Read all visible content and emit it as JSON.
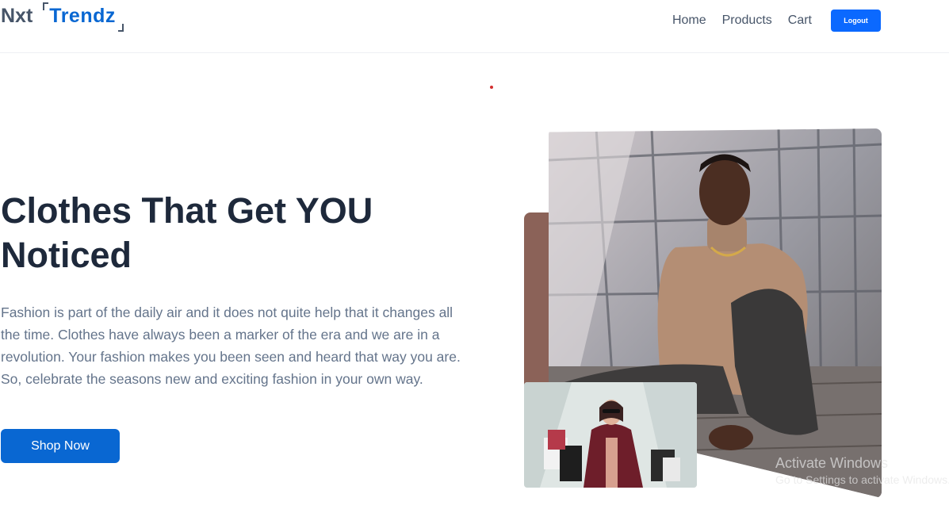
{
  "header": {
    "logo": {
      "part1": "Nxt",
      "part2": "Trendz"
    },
    "nav": [
      {
        "label": "Home"
      },
      {
        "label": "Products"
      },
      {
        "label": "Cart"
      }
    ],
    "logout_label": "Logout"
  },
  "hero": {
    "title": "Clothes That Get YOU Noticed",
    "description": "Fashion is part of the daily air and it does not quite help that it changes all the time. Clothes have always been a marker of the era and we are in a revolution. Your fashion makes you been seen and heard that way you are. So, celebrate the seasons new and exciting fashion in your own way.",
    "cta_label": "Shop Now"
  },
  "watermark": {
    "title": "Activate Windows",
    "subtitle": "Go to Settings to activate Windows."
  },
  "colors": {
    "brand_blue": "#0967d2",
    "logout_blue": "#0b69ff",
    "heading": "#1e293b",
    "body_text": "#64748b",
    "accent_brown": "#8b6258"
  }
}
